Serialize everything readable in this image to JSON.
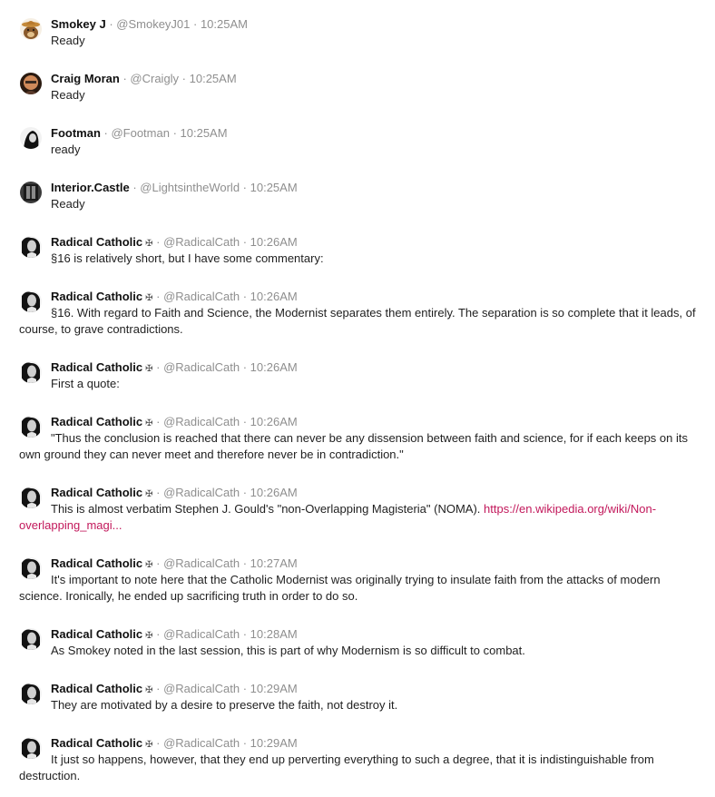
{
  "messages": [
    {
      "name": "Smokey J",
      "handle": "@SmokeyJ01",
      "time": "10:25AM",
      "text": "Ready"
    },
    {
      "name": "Craig Moran",
      "handle": "@Craigly",
      "time": "10:25AM",
      "text": "Ready"
    },
    {
      "name": "Footman",
      "handle": "@Footman",
      "time": "10:25AM",
      "text": "ready"
    },
    {
      "name": "Interior.Castle",
      "handle": "@LightsintheWorld",
      "time": "10:25AM",
      "text": "Ready"
    },
    {
      "name": "Radical Catholic",
      "badge": "✠",
      "handle": "@RadicalCath",
      "time": "10:26AM",
      "text": "§16 is relatively short, but I have some commentary:"
    },
    {
      "name": "Radical Catholic",
      "badge": "✠",
      "handle": "@RadicalCath",
      "time": "10:26AM",
      "text": "§16. With regard to Faith and Science, the Modernist separates them entirely. The separation is so complete that it leads, of course, to grave contradictions."
    },
    {
      "name": "Radical Catholic",
      "badge": "✠",
      "handle": "@RadicalCath",
      "time": "10:26AM",
      "text": "First a quote:"
    },
    {
      "name": "Radical Catholic",
      "badge": "✠",
      "handle": "@RadicalCath",
      "time": "10:26AM",
      "text": "\"Thus the conclusion is reached that there can never be any dissension between faith and science, for if each keeps on its own ground they can never meet and therefore never be in contradiction.\""
    },
    {
      "name": "Radical Catholic",
      "badge": "✠",
      "handle": "@RadicalCath",
      "time": "10:26AM",
      "text": "This is almost verbatim Stephen J. Gould's \"non-Overlapping Magisteria\" (NOMA).",
      "link": "https://en.wikipedia.org/wiki/Non-overlapping_magi..."
    },
    {
      "name": "Radical Catholic",
      "badge": "✠",
      "handle": "@RadicalCath",
      "time": "10:27AM",
      "text": "It's important to note here that the Catholic Modernist was originally trying to insulate faith from the attacks of modern science. Ironically, he ended up sacrificing truth in order to do so."
    },
    {
      "name": "Radical Catholic",
      "badge": "✠",
      "handle": "@RadicalCath",
      "time": "10:28AM",
      "text": "As Smokey noted in the last session, this is part of why Modernism is so difficult to combat."
    },
    {
      "name": "Radical Catholic",
      "badge": "✠",
      "handle": "@RadicalCath",
      "time": "10:29AM",
      "text": "They are motivated by a desire to preserve the faith, not destroy it."
    },
    {
      "name": "Radical Catholic",
      "badge": "✠",
      "handle": "@RadicalCath",
      "time": "10:29AM",
      "text": "It just so happens, however, that they end up perverting everything to such a degree, that it is indistinguishable from destruction."
    }
  ]
}
